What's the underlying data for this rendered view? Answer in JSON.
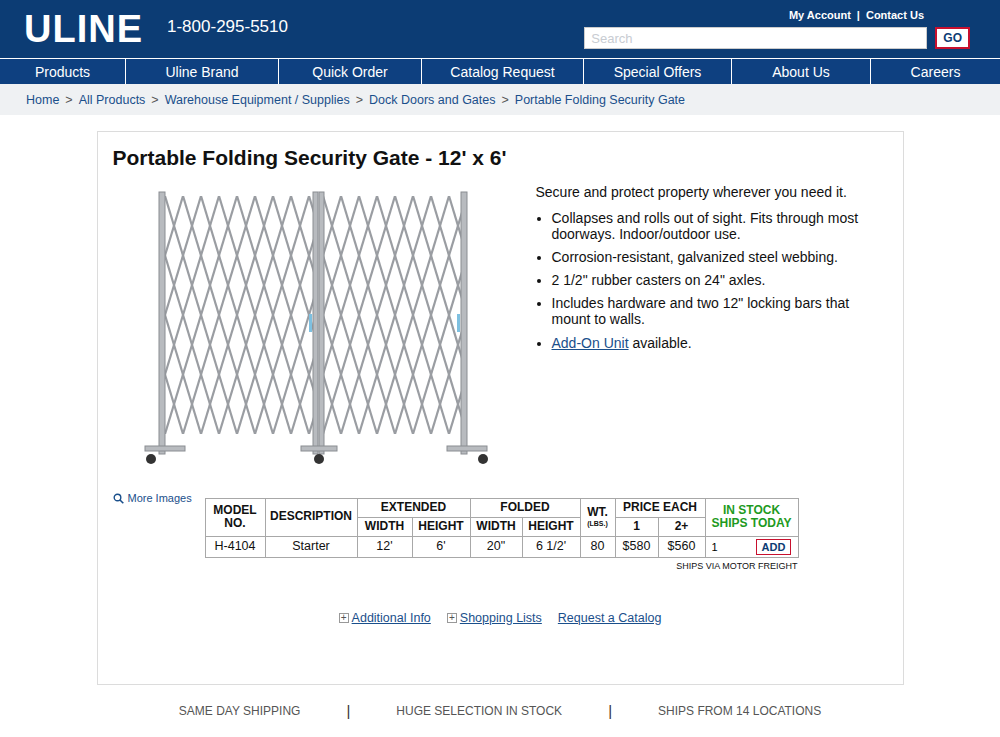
{
  "header": {
    "logo": "ULINE",
    "phone": "1-800-295-5510",
    "account_links": [
      "My Account",
      "Contact Us"
    ],
    "separator": "|",
    "search": {
      "placeholder": "Search",
      "button": "GO"
    }
  },
  "nav": [
    {
      "label": "Products"
    },
    {
      "label": "Uline Brand"
    },
    {
      "label": "Quick Order"
    },
    {
      "label": "Catalog Request"
    },
    {
      "label": "Special Offers"
    },
    {
      "label": "About Us"
    },
    {
      "label": "Careers"
    }
  ],
  "breadcrumb": {
    "separator": ">",
    "items": [
      "Home",
      "All Products",
      "Warehouse Equipment / Supplies",
      "Dock Doors and Gates",
      "Portable Folding Security Gate"
    ]
  },
  "product": {
    "title": "Portable Folding Security Gate - 12' x 6'",
    "image_link": "More Images",
    "tagline": "Secure and protect property wherever you need it.",
    "bullets": [
      {
        "text": "Collapses and rolls out of sight. Fits through most doorways. Indoor/outdoor use.",
        "link": null
      },
      {
        "text": "Corrosion-resistant, galvanized steel webbing.",
        "link": null
      },
      {
        "text": "2 1/2\" rubber casters on 24\" axles.",
        "link": null
      },
      {
        "text": "Includes hardware and two 12\" locking bars that mount to walls.",
        "link": null
      },
      {
        "text": " available.",
        "link": "Add-On Unit"
      }
    ]
  },
  "table": {
    "columns": [
      {
        "label": "MODEL NO.",
        "sub": [],
        "note": null,
        "kind": "plain"
      },
      {
        "label": "DESCRIPTION",
        "sub": [],
        "note": null,
        "kind": "plain"
      },
      {
        "label": "EXTENDED",
        "sub": [
          "WIDTH",
          "HEIGHT"
        ],
        "note": null,
        "kind": "group"
      },
      {
        "label": "FOLDED",
        "sub": [
          "WIDTH",
          "HEIGHT"
        ],
        "note": null,
        "kind": "group"
      },
      {
        "label": "WT.",
        "sub": [],
        "note": "(LBS.)",
        "kind": "plain"
      },
      {
        "label": "PRICE EACH",
        "sub": [
          "1",
          "2+"
        ],
        "note": null,
        "kind": "group"
      },
      {
        "label": "IN STOCK SHIPS TODAY",
        "sub": [],
        "note": null,
        "kind": "stock"
      }
    ],
    "rows": [
      {
        "cells": [
          "H-4104",
          "Starter",
          "12'",
          "6'",
          "20\"",
          "6 1/2'",
          "80",
          "$580",
          "$560"
        ],
        "quantity": "1",
        "button": "ADD"
      }
    ],
    "shipping_note": "SHIPS VIA MOTOR FREIGHT"
  },
  "links": [
    {
      "icon": "+",
      "label": "Additional Info"
    },
    {
      "icon": "+",
      "label": "Shopping Lists"
    },
    {
      "icon": null,
      "label": "Request a Catalog"
    }
  ],
  "footer": {
    "separator": "|",
    "items": [
      "SAME DAY SHIPPING",
      "HUGE SELECTION IN STOCK",
      "SHIPS FROM 14 LOCATIONS"
    ]
  }
}
